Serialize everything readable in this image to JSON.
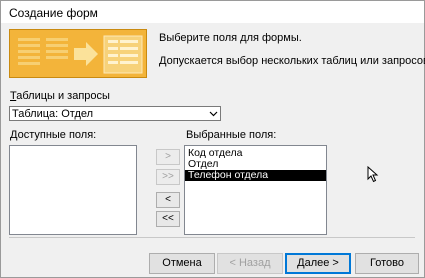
{
  "window": {
    "title": "Создание форм"
  },
  "intro": {
    "line1": "Выберите поля для формы.",
    "line2": "Допускается выбор нескольких таблиц или запросов."
  },
  "source": {
    "label_u": "Т",
    "label_rest": "аблицы и запросы",
    "selected": "Таблица: Отдел"
  },
  "available": {
    "label_u": "Д",
    "label_rest": "оступные поля:",
    "items": []
  },
  "selected_fields": {
    "label": "Выбранные поля:",
    "items": [
      "Код отдела",
      "Отдел",
      "Телефон отдела"
    ],
    "highlighted_index": 2
  },
  "move_buttons": {
    "add_one": ">",
    "add_all": ">>",
    "remove_one": "<",
    "remove_all": "<<"
  },
  "buttons": {
    "cancel": "Отмена",
    "back": "< Назад",
    "next": "Далее >",
    "finish": "Готово"
  },
  "colors": {
    "accent": "#0078d7",
    "wizard_image": "#f0b030",
    "selection": "#000000"
  }
}
